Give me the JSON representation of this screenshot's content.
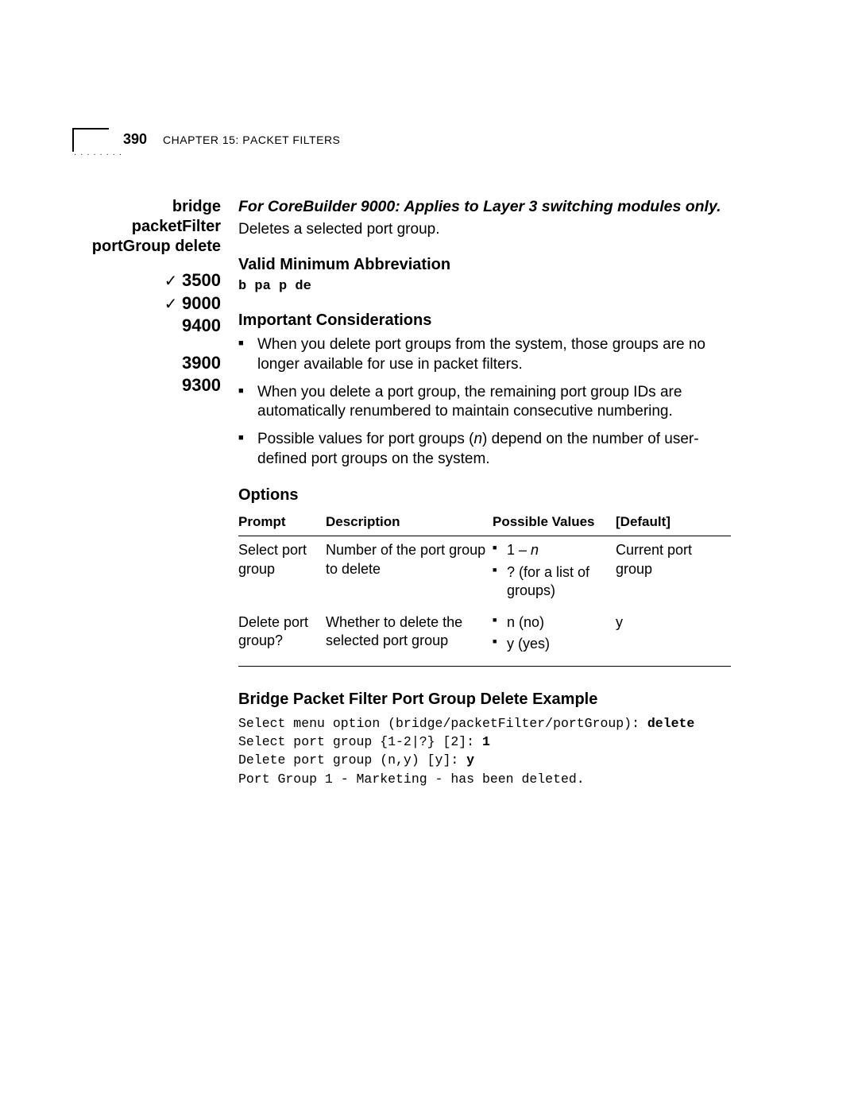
{
  "header": {
    "page_number": "390",
    "chapter_label": "Chapter 15: Packet Filters"
  },
  "left": {
    "command_line1": "bridge packetFilter",
    "command_line2": "portGroup delete",
    "models": {
      "m1_check": "✓",
      "m1": "3500",
      "m2_check": "✓",
      "m2": "9000",
      "m3_check": "",
      "m3": "9400",
      "m4_check": "",
      "m4": "3900",
      "m5_check": "",
      "m5": "9300"
    }
  },
  "content": {
    "applies_note": "For CoreBuilder 9000: Applies to Layer 3 switching modules only.",
    "intro": "Deletes a selected port group.",
    "abbrev_heading": "Valid Minimum Abbreviation",
    "abbrev": "b pa p de",
    "considerations_heading": "Important Considerations",
    "bullets": {
      "b1": "When you delete port groups from the system, those groups are no longer available for use in packet filters.",
      "b2": "When you delete a port group, the remaining port group IDs are automatically renumbered to maintain consecutive numbering.",
      "b3_pre": "Possible values for port groups (",
      "b3_var": "n",
      "b3_post": ") depend on the number of user-defined port groups on the system."
    },
    "options_heading": "Options",
    "table": {
      "h_prompt": "Prompt",
      "h_desc": "Description",
      "h_values": "Possible Values",
      "h_default": "[Default]",
      "r1": {
        "prompt": "Select port group",
        "desc": "Number of the port group to delete",
        "val1_pre": "1 – ",
        "val1_var": "n",
        "val2": "? (for a list of groups)",
        "def": "Current port group"
      },
      "r2": {
        "prompt": "Delete port group?",
        "desc": "Whether to delete the selected port group",
        "val1": "n (no)",
        "val2": "y (yes)",
        "def": "y"
      }
    },
    "example_heading": "Bridge Packet Filter Port Group Delete Example",
    "example": {
      "l1a": "Select menu option (bridge/packetFilter/portGroup): ",
      "l1b": "delete",
      "l2a": "Select port group {1-2|?} [2]: ",
      "l2b": "1",
      "l3a": "Delete port group (n,y) [y]: ",
      "l3b": "y",
      "l4": "Port Group 1 - Marketing - has been deleted."
    }
  }
}
